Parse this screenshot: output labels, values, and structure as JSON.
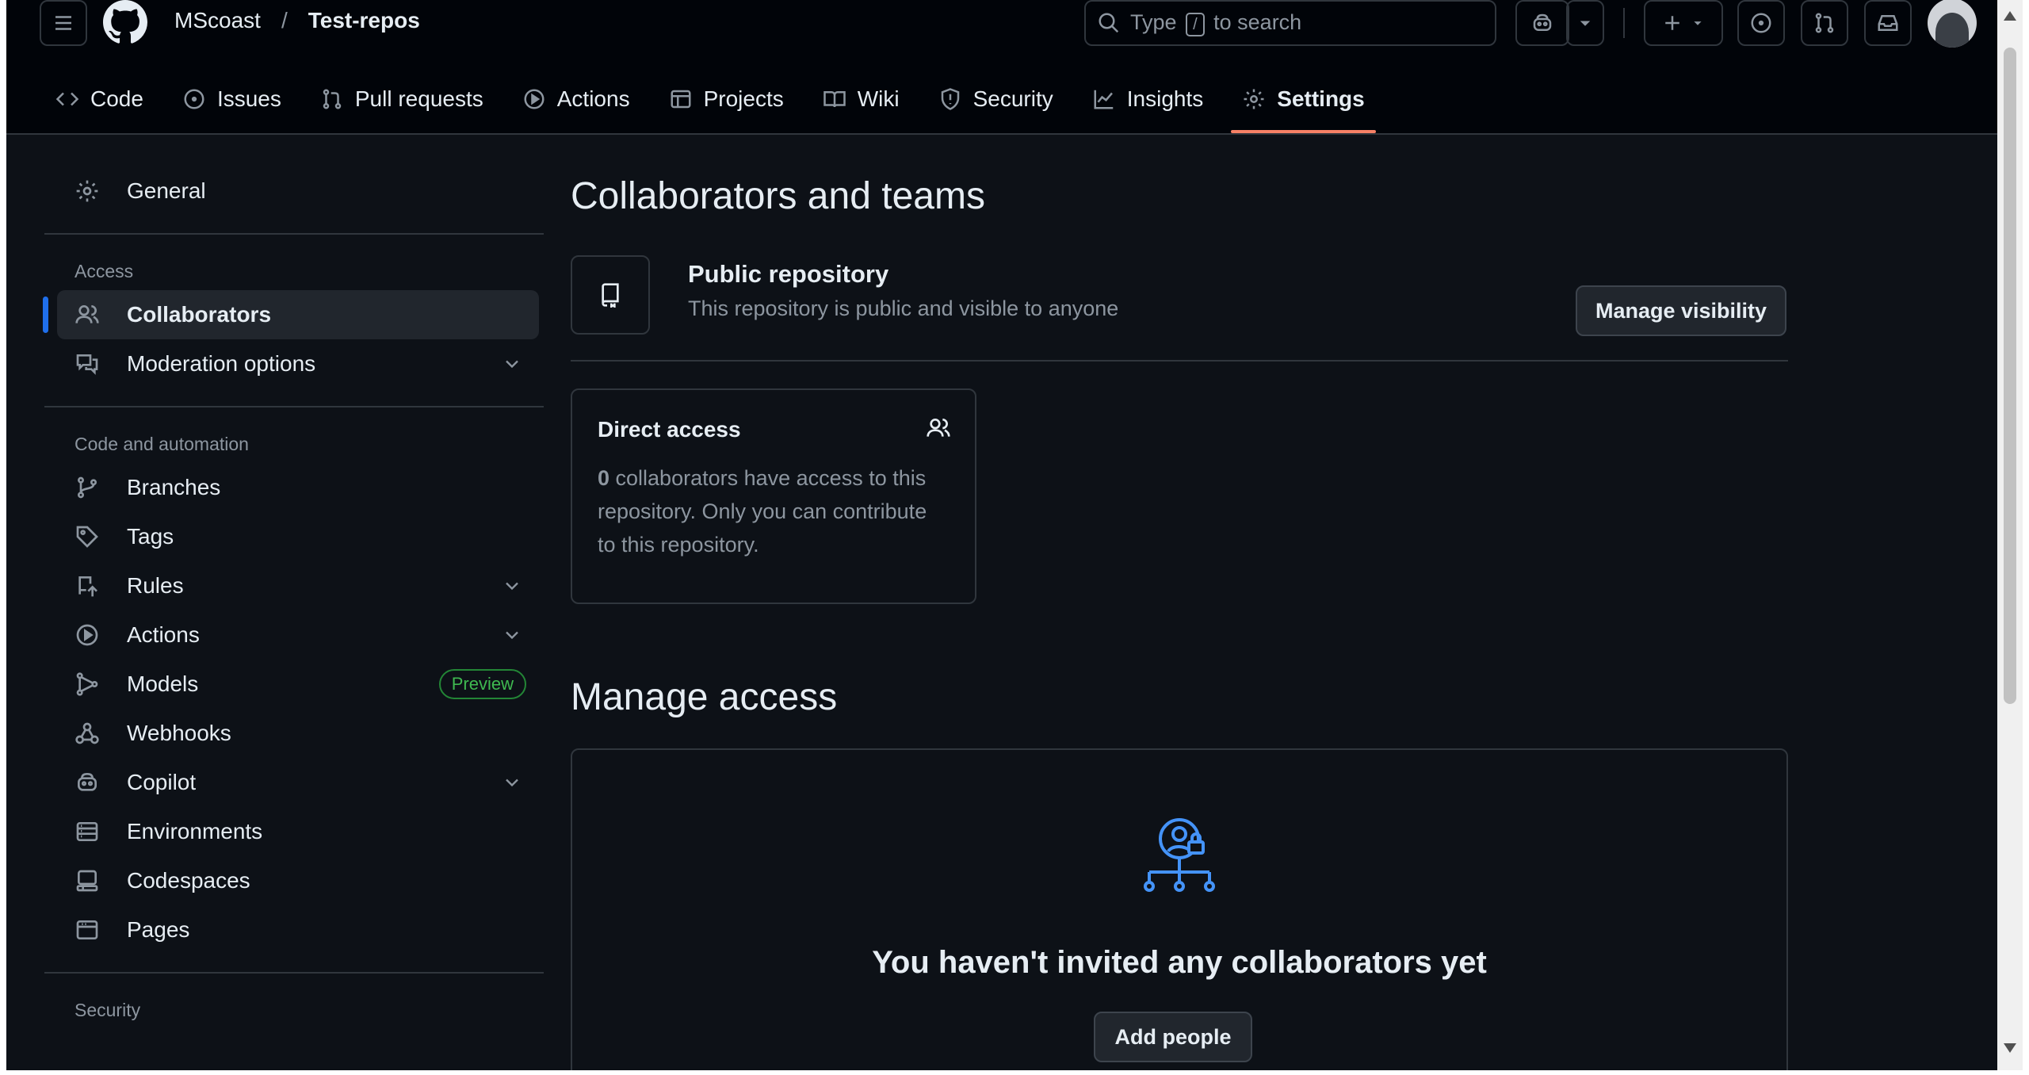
{
  "header": {
    "owner": "MScoast",
    "separator": "/",
    "repo": "Test-repos",
    "search_prefix": "Type",
    "search_key": "/",
    "search_suffix": "to search"
  },
  "tabs": [
    {
      "label": "Code",
      "icon": "code-icon"
    },
    {
      "label": "Issues",
      "icon": "issue-icon"
    },
    {
      "label": "Pull requests",
      "icon": "pull-request-icon"
    },
    {
      "label": "Actions",
      "icon": "play-icon"
    },
    {
      "label": "Projects",
      "icon": "table-icon"
    },
    {
      "label": "Wiki",
      "icon": "book-icon"
    },
    {
      "label": "Security",
      "icon": "shield-icon"
    },
    {
      "label": "Insights",
      "icon": "graph-icon"
    },
    {
      "label": "Settings",
      "icon": "gear-icon",
      "active": true
    }
  ],
  "sidebar": {
    "general": "General",
    "access_heading": "Access",
    "collaborators": "Collaborators",
    "moderation": "Moderation options",
    "code_heading": "Code and automation",
    "branches": "Branches",
    "tags": "Tags",
    "rules": "Rules",
    "actions": "Actions",
    "models": "Models",
    "models_badge": "Preview",
    "webhooks": "Webhooks",
    "copilot": "Copilot",
    "environments": "Environments",
    "codespaces": "Codespaces",
    "pages": "Pages",
    "security_heading": "Security"
  },
  "main": {
    "title": "Collaborators and teams",
    "visibility_title": "Public repository",
    "visibility_desc": "This repository is public and visible to anyone",
    "manage_visibility": "Manage visibility",
    "direct_title": "Direct access",
    "direct_count": "0",
    "direct_desc_1": " collaborators have access to this",
    "direct_desc_2": "repository. Only you can contribute",
    "direct_desc_3": "to this repository.",
    "manage_title": "Manage access",
    "empty_title": "You haven't invited any collaborators yet",
    "add_people": "Add people"
  },
  "colors": {
    "accent": "#1f6feb",
    "tab_underline": "#f78166",
    "preview_badge": "#3fb950",
    "illustration": "#4493f8"
  }
}
